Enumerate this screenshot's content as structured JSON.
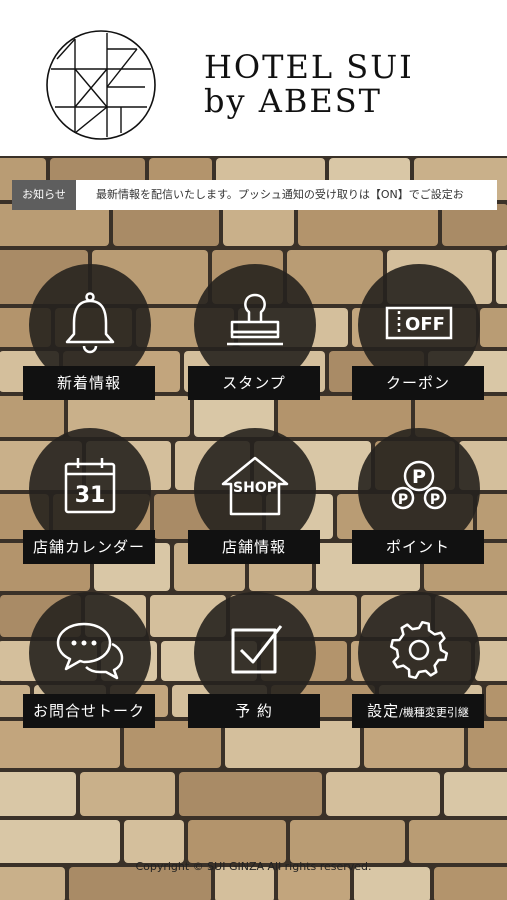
{
  "brand": {
    "line1": "HOTEL SUI",
    "line2": "by ABEST"
  },
  "news": {
    "label": "お知らせ",
    "text": "最新情報を配信いたします。プッシュ通知の受け取りは【ON】でご設定お"
  },
  "menu": [
    {
      "label": "新着情報",
      "icon": "bell-icon"
    },
    {
      "label": "スタンプ",
      "icon": "stamp-icon"
    },
    {
      "label": "クーポン",
      "icon": "coupon-icon",
      "icon_text": "OFF"
    },
    {
      "label": "店舗カレンダー",
      "icon": "calendar-icon",
      "icon_text": "31"
    },
    {
      "label": "店舗情報",
      "icon": "shop-icon",
      "icon_text": "SHOP"
    },
    {
      "label": "ポイント",
      "icon": "points-icon",
      "icon_text": "P"
    },
    {
      "label": "お問合せトーク",
      "icon": "chat-icon"
    },
    {
      "label": "予 約",
      "icon": "checkbox-icon"
    },
    {
      "label": "設定",
      "label_sub": "/機種変更引継",
      "icon": "gear-icon"
    }
  ],
  "footer": {
    "copyright": "Copyright © SUI GINZA All rights reserved."
  },
  "colors": {
    "label_bg": "#111111",
    "circle_bg": "#26221e",
    "news_label_bg": "#5e5e5e"
  }
}
